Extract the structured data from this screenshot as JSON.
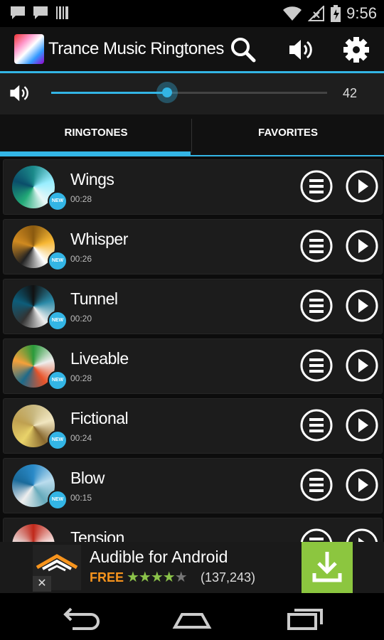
{
  "status": {
    "time": "9:56"
  },
  "app": {
    "title": "Trance Music Ringtones"
  },
  "volume": {
    "value": "42",
    "level": 0.42
  },
  "tabs": [
    {
      "label": "RINGTONES",
      "active": true
    },
    {
      "label": "FAVORITES",
      "active": false
    }
  ],
  "badge_text": "NEW",
  "ringtones": [
    {
      "name": "Wings",
      "duration": "00:28"
    },
    {
      "name": "Whisper",
      "duration": "00:26"
    },
    {
      "name": "Tunnel",
      "duration": "00:20"
    },
    {
      "name": "Liveable",
      "duration": "00:28"
    },
    {
      "name": "Fictional",
      "duration": "00:24"
    },
    {
      "name": "Blow",
      "duration": "00:15"
    },
    {
      "name": "Tension",
      "duration": ""
    }
  ],
  "ad": {
    "title": "Audible for Android",
    "price": "FREE",
    "reviews": "(137,243)",
    "rating": 4.5,
    "close": "✕"
  },
  "colors": {
    "accent": "#33b5e5",
    "ad_download": "#8cc63f",
    "ad_free": "#f7941d"
  }
}
